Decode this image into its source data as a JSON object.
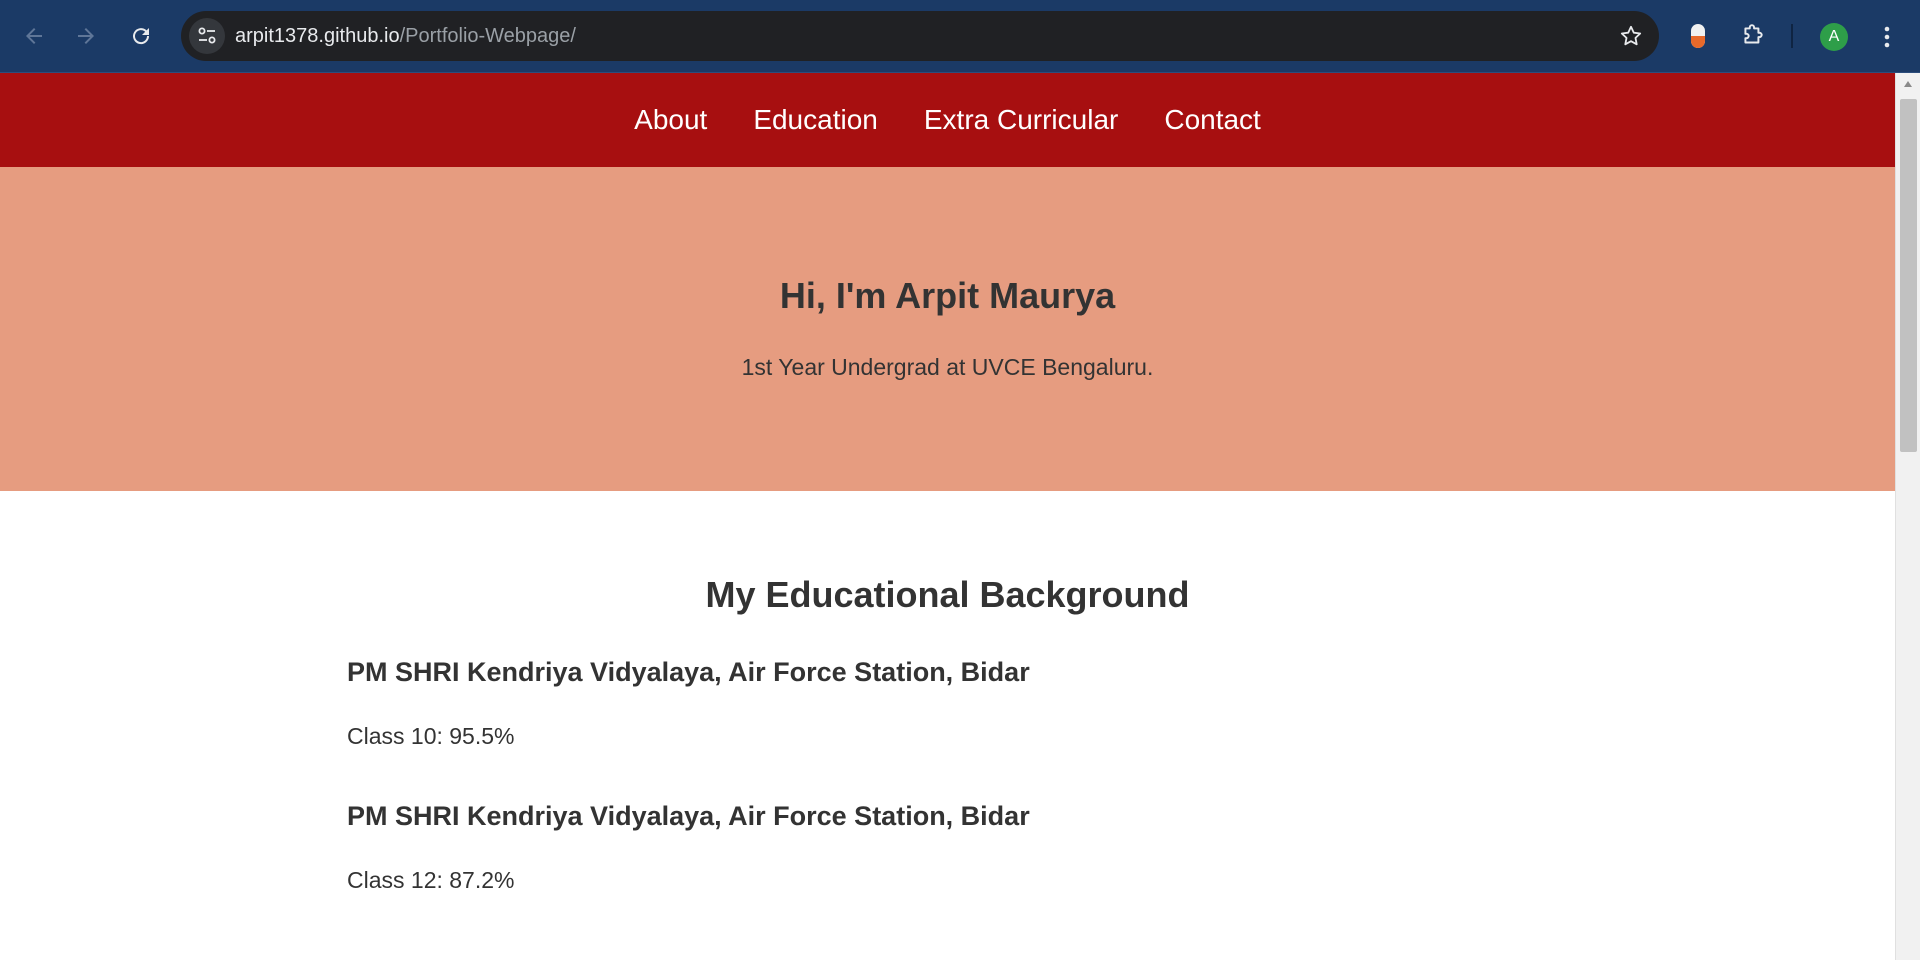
{
  "browser": {
    "url_host": "arpit1378.github.io",
    "url_path": "/Portfolio-Webpage/",
    "profile_initial": "A",
    "icons": {
      "back": "arrow-left-icon",
      "forward": "arrow-right-icon",
      "reload": "reload-icon",
      "site_info": "tune-icon",
      "bookmark": "star-icon",
      "extension_1": "capsule-extension-icon",
      "extensions": "puzzle-icon",
      "menu": "kebab-menu-icon"
    }
  },
  "site": {
    "nav": [
      "About",
      "Education",
      "Extra Curricular",
      "Contact"
    ],
    "hero": {
      "title": "Hi, I'm Arpit Maurya",
      "subtitle": "1st Year Undergrad at UVCE Bengaluru."
    },
    "education": {
      "heading": "My Educational Background",
      "items": [
        {
          "school": "PM SHRI Kendriya Vidyalaya, Air Force Station, Bidar",
          "score": "Class 10: 95.5%"
        },
        {
          "school": "PM SHRI Kendriya Vidyalaya, Air Force Station, Bidar",
          "score": "Class 12: 87.2%"
        }
      ]
    }
  },
  "colors": {
    "browser_frame": "#1b3a66",
    "omnibox": "#202124",
    "nav_bg": "#a70f10",
    "hero_bg": "#e69c80",
    "text": "#333333",
    "avatar": "#2e9e49"
  }
}
